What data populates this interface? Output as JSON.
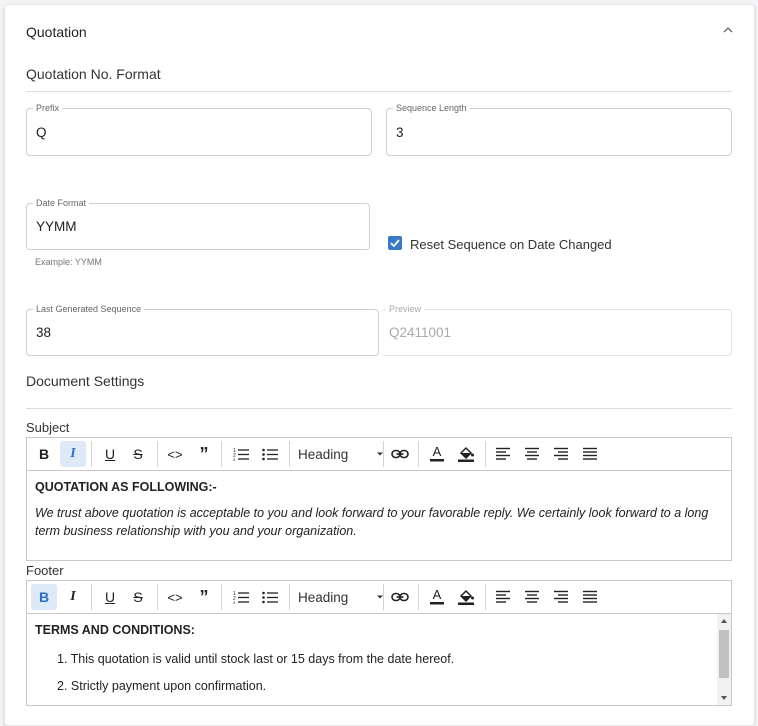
{
  "card": {
    "title": "Quotation"
  },
  "quotation_no_format": {
    "heading": "Quotation No. Format",
    "prefix": {
      "label": "Prefix",
      "value": "Q"
    },
    "sequence_length": {
      "label": "Sequence Length",
      "value": "3"
    },
    "date_format": {
      "label": "Date Format",
      "value": "YYMM",
      "helper": "Example: YYMM"
    },
    "reset_sequence": {
      "label": "Reset Sequence on Date Changed",
      "checked": true
    },
    "last_generated_sequence": {
      "label": "Last Generated Sequence",
      "value": "38"
    },
    "preview": {
      "label": "Preview",
      "value": "Q2411001"
    }
  },
  "document_settings": {
    "heading": "Document Settings",
    "subject": {
      "label": "Subject",
      "toolbar": {
        "heading_label": "Heading",
        "active": [
          "italic"
        ]
      },
      "title_text": "QUOTATION AS FOLLOWING:-",
      "body_text": "We trust above quotation is acceptable to you and look forward to your favorable reply. We certainly look forward to a long term business relationship with you and your organization."
    },
    "footer": {
      "label": "Footer",
      "toolbar": {
        "heading_label": "Heading",
        "active": [
          "bold"
        ]
      },
      "title_text": "TERMS AND CONDITIONS:",
      "items": [
        "1. This quotation is valid until stock last or 15 days from the date hereof.",
        "2. Strictly payment upon confirmation."
      ]
    }
  },
  "colors": {
    "accent": "#3a78c9",
    "active_bg": "#dde9f7"
  }
}
